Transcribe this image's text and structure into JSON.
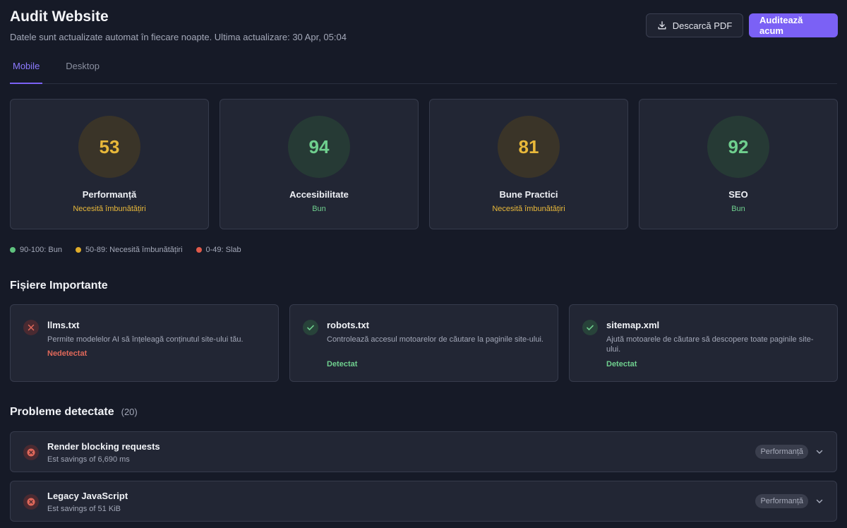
{
  "header": {
    "title": "Audit Website",
    "subtitle": "Datele sunt actualizate automat în fiecare noapte. Ultima actualizare: 30 Apr, 05:04",
    "download_label": "Descarcă PDF",
    "audit_label": "Auditează acum"
  },
  "tabs": [
    {
      "label": "Mobile",
      "active": true
    },
    {
      "label": "Desktop",
      "active": false
    }
  ],
  "scores": [
    {
      "value": "53",
      "name": "Performanță",
      "status": "Necesită îmbunătățiri",
      "level": "medium"
    },
    {
      "value": "94",
      "name": "Accesibilitate",
      "status": "Bun",
      "level": "good"
    },
    {
      "value": "81",
      "name": "Bune Practici",
      "status": "Necesită îmbunătățiri",
      "level": "medium"
    },
    {
      "value": "92",
      "name": "SEO",
      "status": "Bun",
      "level": "good"
    }
  ],
  "legend": [
    {
      "label": "90-100: Bun",
      "color": "#5fc27e"
    },
    {
      "label": "50-89: Necesită îmbunătățiri",
      "color": "#e0ac2a"
    },
    {
      "label": "0-49: Slab",
      "color": "#e05a4a"
    }
  ],
  "files_section": {
    "title": "Fișiere Importante",
    "items": [
      {
        "name": "llms.txt",
        "description": "Permite modelelor AI să înțeleagă conținutul site-ului tău.",
        "status": "Nedetectat",
        "detected": false
      },
      {
        "name": "robots.txt",
        "description": "Controlează accesul motoarelor de căutare la paginile site-ului.",
        "status": "Detectat",
        "detected": true
      },
      {
        "name": "sitemap.xml",
        "description": "Ajută motoarele de căutare să descopere toate paginile site-ului.",
        "status": "Detectat",
        "detected": true
      }
    ]
  },
  "issues_section": {
    "title": "Probleme detectate",
    "count": "(20)",
    "items": [
      {
        "title": "Render blocking requests",
        "subtitle": "Est savings of 6,690 ms",
        "category": "Performanță"
      },
      {
        "title": "Legacy JavaScript",
        "subtitle": "Est savings of 51 KiB",
        "category": "Performanță"
      }
    ]
  },
  "colors": {
    "accent": "#7b61f5",
    "good": "#6fcf8e",
    "medium": "#e8b83a",
    "bad": "#e0685a"
  }
}
